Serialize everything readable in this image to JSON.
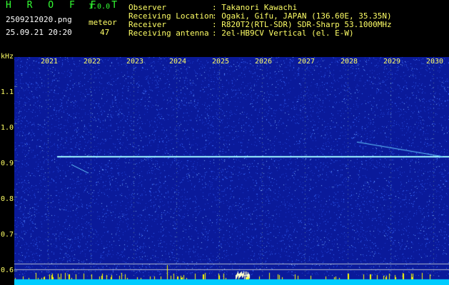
{
  "header": {
    "app_title": "H R O F F T",
    "app_version": "1.0.0",
    "file_name": "2509212020.png",
    "datetime": "25.09.21 20:20",
    "meteor_label": "meteor",
    "meteor_count": "47",
    "info": [
      {
        "label": "Observer",
        "value": ": Takanori Kawachi"
      },
      {
        "label": "Receiving Location",
        "value": ": Ogaki, Gifu, JAPAN (136.60E, 35.35N)"
      },
      {
        "label": "Receiver",
        "value": ": R820T2(RTL-SDR) SDR-Sharp 53.1000MHz"
      },
      {
        "label": "Receiving antenna",
        "value": ": 2el-HB9CV Vertical (el. E-W)"
      }
    ]
  },
  "chart_data": {
    "type": "heatmap",
    "ylabel": "kHz",
    "y_ticks": [
      "1.1",
      "1.0",
      "0.9",
      "0.8",
      "0.7",
      "0.6"
    ],
    "x_ticks": [
      "2021",
      "2022",
      "2023",
      "2024",
      "2025",
      "2026",
      "2027",
      "2028",
      "2029",
      "2030"
    ],
    "ylim": [
      0.58,
      1.18
    ],
    "carrier_khz": 0.91,
    "grid": true,
    "colors": {
      "background": "#0a1a9a",
      "noise": "#3a6cff",
      "carrier": "#9ff7ff",
      "grid": "#5a7aa0",
      "spikes": "#ffff00",
      "floor": "#00ccff"
    }
  }
}
